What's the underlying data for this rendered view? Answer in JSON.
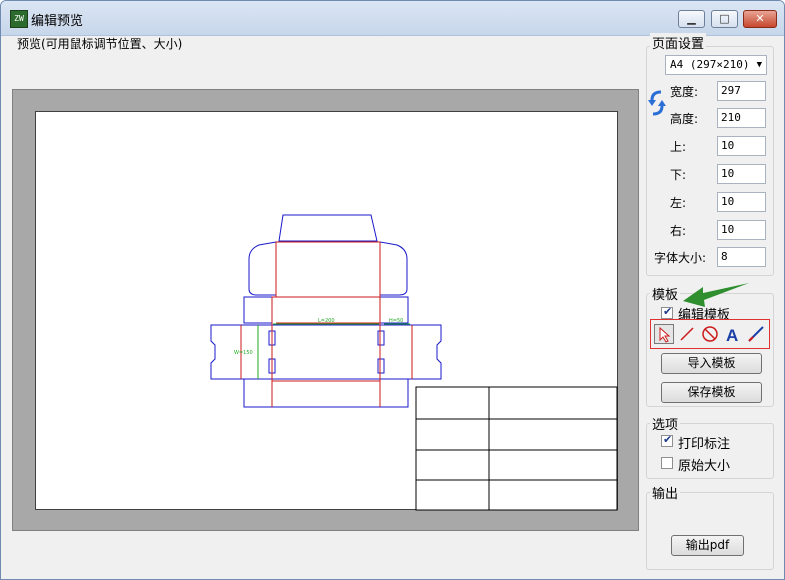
{
  "window": {
    "title": "编辑预览",
    "icon_text": "ZW",
    "controls": {
      "minimize": "▁",
      "maximize": "□",
      "close": "✕"
    }
  },
  "preview": {
    "label": "预览(可用鼠标调节位置、大小)"
  },
  "page_setup": {
    "title": "页面设置",
    "paper_size": "A4 (297×210)",
    "width_label": "宽度:",
    "width_value": "297",
    "height_label": "高度:",
    "height_value": "210",
    "top_label": "上:",
    "top_value": "10",
    "bottom_label": "下:",
    "bottom_value": "10",
    "left_label": "左:",
    "left_value": "10",
    "right_label": "右:",
    "right_value": "10",
    "font_size_label": "字体大小:",
    "font_size_value": "8"
  },
  "template": {
    "title": "模板",
    "edit_checkbox_label": "编辑模板",
    "edit_checked": true,
    "tools": [
      "select-arrow-icon",
      "line-icon",
      "no-entry-icon",
      "text-icon",
      "pen-icon"
    ],
    "import_button": "导入模板",
    "save_button": "保存模板"
  },
  "options": {
    "title": "选项",
    "print_label": "打印标注",
    "print_checked": true,
    "original_size_label": "原始大小",
    "original_size_checked": false
  },
  "output": {
    "title": "输出",
    "pdf_button": "输出pdf"
  },
  "drawing": {
    "dim_length": "L=200",
    "dim_width": "W=150",
    "dim_height": "H=50"
  },
  "colors": {
    "outline": "#1a1acc",
    "fold": "#cc1a1a",
    "dimension": "#22aa22",
    "arrow": "#2f8f2f"
  }
}
